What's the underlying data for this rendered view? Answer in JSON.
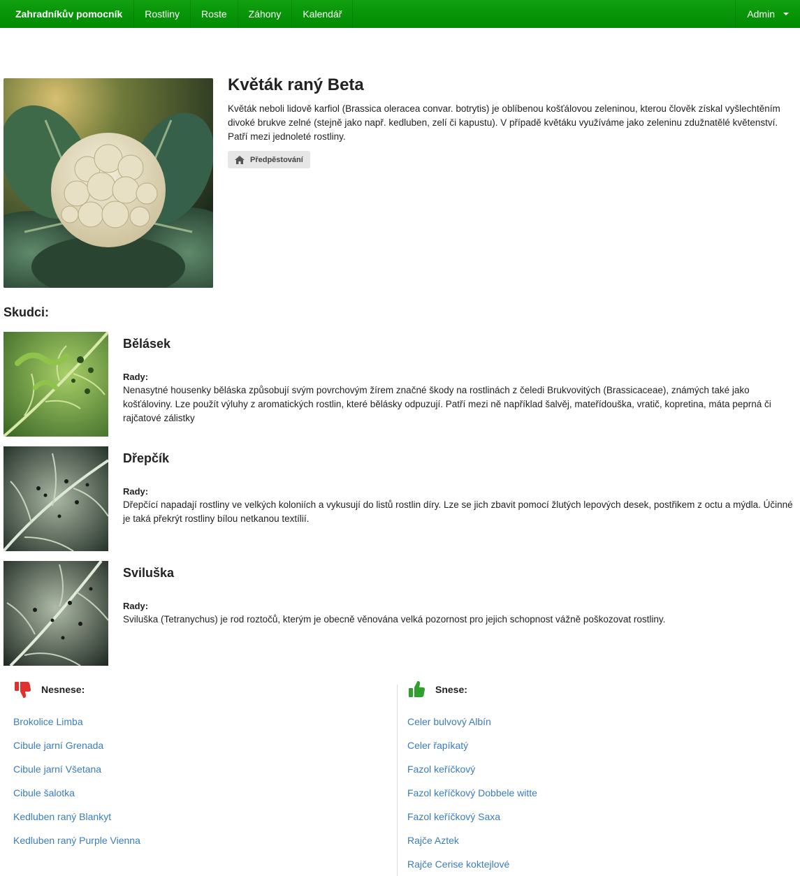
{
  "nav": {
    "brand": "Zahradníkův pomocník",
    "links": [
      "Rostliny",
      "Roste",
      "Záhony",
      "Kalendář"
    ],
    "user": "Admin"
  },
  "plant": {
    "title": "Květák raný Beta",
    "description": "Květák neboli lidově karfiol (Brassica oleracea convar. botrytis) je oblíbenou košťálovou zeleninou, kterou člověk získal vyšlechtěním divoké brukve zelné (stejně jako např. kedluben, zelí či kapustu). V případě květáku využíváme jako zeleninu zdužnatělé květenství. Patří mezi jednoleté rostliny.",
    "tag": "Předpěstování",
    "tag_icon": "home-icon"
  },
  "pests": {
    "title": "Skudci:",
    "advice_label": "Rady:",
    "items": [
      {
        "name": "Bělásek",
        "advice": "Nenasytné housenky běláska způsobují svým povrchovým žírem značné škody na rostlinách z čeledi Brukvovitých (Brassicaceae), známých také jako košťáloviny. Lze použít výluhy z aromatických rostlin, které bělásky odpuzují. Patří mezi ně například šalvěj, mateřídouška, vratič, kopretina, máta peprná či rajčatové zálistky"
      },
      {
        "name": "Dřepčík",
        "advice": "Dřepčící napadají rostliny ve velkých koloniích a vykusují do listů rostlin díry. Lze se jich zbavit pomocí žlutých lepových desek, postřikem z octu a mýdla. Účinné je taká překrýt rostliny bílou netkanou textílií."
      },
      {
        "name": "Sviluška",
        "advice": "Sviluška (Tetranychus) je rod roztočů, kterým je obecně věnována velká pozornost pro jejich schopnost vážně poškozovat rostliny."
      }
    ]
  },
  "companions": {
    "bad_title": "Nesnese:",
    "bad_icon": "thumbs-down-icon",
    "bad_color": "#e03030",
    "bad": [
      "Brokolice Limba",
      "Cibule jarní Grenada",
      "Cibule jarní Všetana",
      "Cibule šalotka",
      "Kedluben raný Blankyt",
      "Kedluben raný Purple Vienna"
    ],
    "good_title": "Snese:",
    "good_icon": "thumbs-up-icon",
    "good_color": "#2ea02e",
    "good": [
      "Celer bulvový Albín",
      "Celer řapíkatý",
      "Fazol keříčkový",
      "Fazol keříčkový Dobbele witte",
      "Fazol keříčkový Saxa",
      "Rajče Aztek",
      "Rajče Cerise koktejlové"
    ]
  },
  "colors": {
    "navbar": "#0a960a",
    "link": "#3a7cc0"
  }
}
